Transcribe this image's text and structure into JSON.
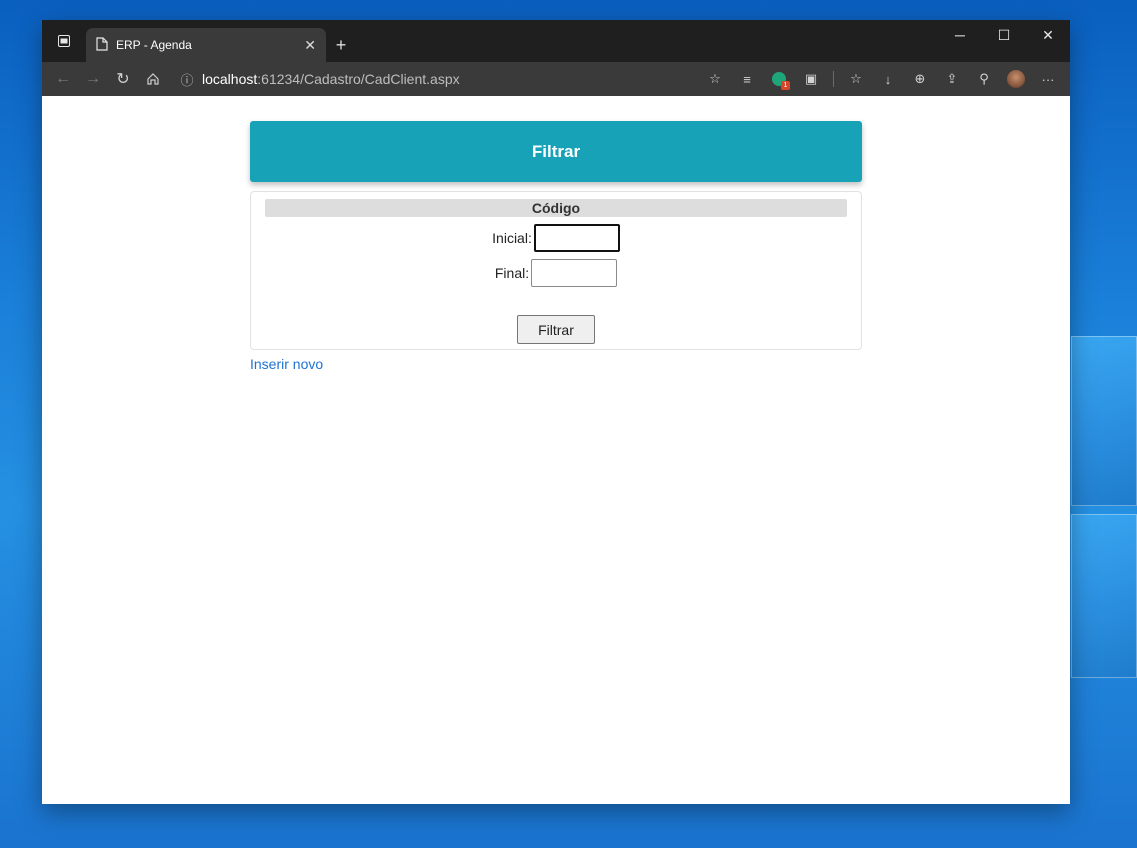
{
  "browser": {
    "tab_title": "ERP - Agenda",
    "url_host": "localhost",
    "url_rest": ":61234/Cadastro/CadClient.aspx",
    "notification_badge": "1"
  },
  "page": {
    "header_title": "Filtrar",
    "section_title": "Código",
    "fields": [
      {
        "label": "Inicial:",
        "value": ""
      },
      {
        "label": "Final:",
        "value": ""
      }
    ],
    "filter_button_label": "Filtrar",
    "insert_link_label": "Inserir novo"
  },
  "colors": {
    "header_bg": "#17a2b8",
    "link": "#1e73d2",
    "section_bar": "#dddddd"
  }
}
